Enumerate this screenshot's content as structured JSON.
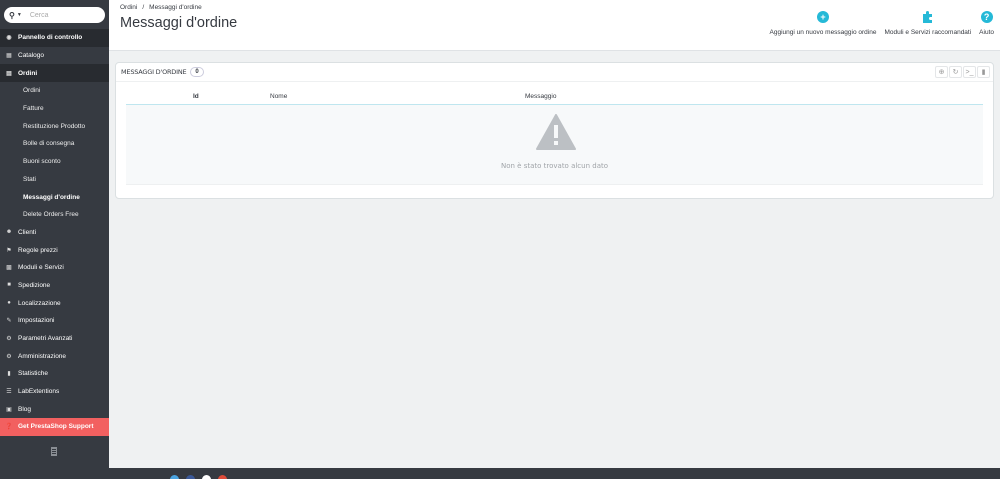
{
  "search": {
    "placeholder": "Cerca"
  },
  "sidebar": {
    "items": [
      {
        "label": "Pannello di controllo",
        "icon": "dashboard-icon"
      },
      {
        "label": "Catalogo",
        "icon": "catalog-icon"
      },
      {
        "label": "Ordini",
        "icon": "orders-icon"
      },
      {
        "label": "Ordini"
      },
      {
        "label": "Fatture"
      },
      {
        "label": "Restituzione Prodotto"
      },
      {
        "label": "Bolle di consegna"
      },
      {
        "label": "Buoni sconto"
      },
      {
        "label": "Stati"
      },
      {
        "label": "Messaggi d'ordine"
      },
      {
        "label": "Delete Orders Free"
      },
      {
        "label": "Clienti",
        "icon": "customers-icon"
      },
      {
        "label": "Regole prezzi",
        "icon": "price-rules-icon"
      },
      {
        "label": "Moduli e Servizi",
        "icon": "modules-icon"
      },
      {
        "label": "Spedizione",
        "icon": "shipping-icon"
      },
      {
        "label": "Localizzazione",
        "icon": "globe-icon"
      },
      {
        "label": "Impostazioni",
        "icon": "wrench-icon"
      },
      {
        "label": "Parametri Avanzati",
        "icon": "cogs-icon"
      },
      {
        "label": "Amministrazione",
        "icon": "gear-icon"
      },
      {
        "label": "Statistiche",
        "icon": "bar-chart-icon"
      },
      {
        "label": "LabExtentions",
        "icon": "list-icon"
      },
      {
        "label": "Blog",
        "icon": "blog-icon"
      },
      {
        "label": "Get PrestaShop Support",
        "icon": "help-icon"
      }
    ]
  },
  "header": {
    "breadcrumb": [
      "Ordini",
      "/",
      "Messaggi d'ordine"
    ],
    "title": "Messaggi d'ordine",
    "toolbar": {
      "add_label": "Aggiungi un nuovo messaggio ordine",
      "modules_label": "Moduli e Servizi raccomandati",
      "help_label": "Aiuto"
    }
  },
  "panel": {
    "title": "Messaggi d'ordine",
    "count": "0",
    "columns": [
      "Id",
      "Nome",
      "Messaggio"
    ],
    "empty_text": "Non è stato trovato alcun dato"
  },
  "colors": {
    "sidebar_bg": "#363a41",
    "accent": "#25b9d7",
    "support_bg": "#f26060",
    "warning_icon": "#bcc0c4"
  }
}
